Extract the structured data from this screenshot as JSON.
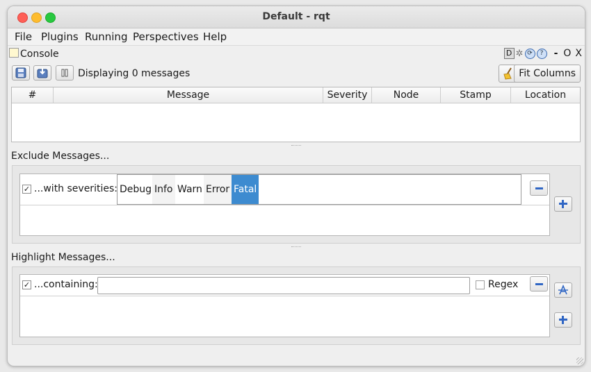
{
  "window": {
    "title": "Default - rqt"
  },
  "menubar": {
    "items": [
      {
        "label": "File"
      },
      {
        "label": "Plugins"
      },
      {
        "label": "Running"
      },
      {
        "label": "Perspectives"
      },
      {
        "label": "Help"
      }
    ]
  },
  "dock": {
    "title": "Console",
    "help_glyph": "?",
    "d_glyph": "D",
    "minus": "-",
    "float": "O",
    "close": "X"
  },
  "toolbar": {
    "status": "Displaying 0 messages",
    "fit_columns": "Fit Columns"
  },
  "table": {
    "columns": [
      "#",
      "Message",
      "Severity",
      "Node",
      "Stamp",
      "Location"
    ],
    "rows": []
  },
  "exclude": {
    "title": "Exclude Messages...",
    "row": {
      "checked": true,
      "label": "...with severities:",
      "severities": [
        {
          "label": "Debug",
          "selected": false
        },
        {
          "label": "Info",
          "selected": false
        },
        {
          "label": "Warn",
          "selected": false
        },
        {
          "label": "Error",
          "selected": false
        },
        {
          "label": "Fatal",
          "selected": true
        }
      ]
    }
  },
  "highlight": {
    "title": "Highlight Messages...",
    "row": {
      "checked": true,
      "label": "...containing:",
      "value": "",
      "regex_label": "Regex",
      "regex_checked": false
    }
  },
  "colors": {
    "selection": "#3d8bd0",
    "icon_blue": "#3066c4"
  },
  "icons": [
    "console-icon",
    "save-icon",
    "load-icon",
    "pause-icon",
    "clear-brush-icon",
    "remove-icon",
    "add-icon",
    "clear-text-icon"
  ]
}
